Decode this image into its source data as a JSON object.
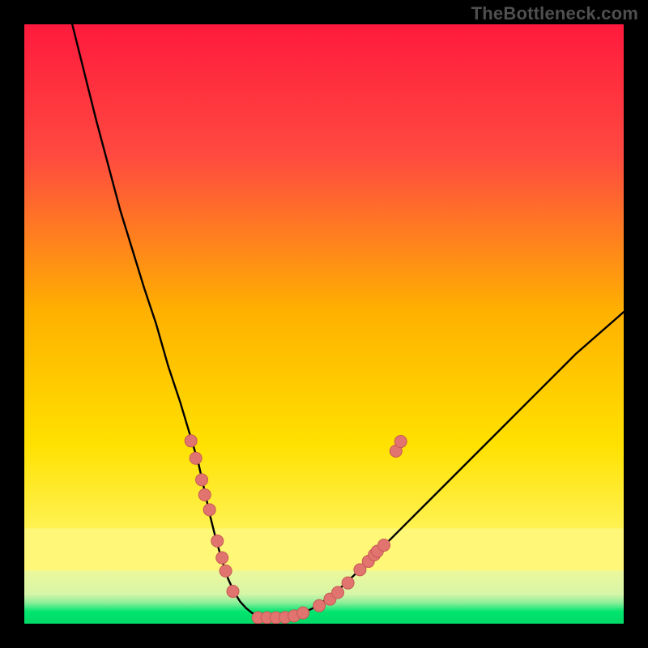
{
  "watermark": "TheBottleneck.com",
  "colors": {
    "frame": "#000000",
    "curve": "#000000",
    "dot_fill": "#e2746f",
    "dot_stroke": "#c65954",
    "grad_top": "#ff1a3d",
    "grad_upper": "#ff5040",
    "grad_mid": "#ffd300",
    "grad_band": "#fff777",
    "grad_lowband": "#ecf79b",
    "grad_green": "#00e56e"
  },
  "chart_data": {
    "type": "line",
    "title": "",
    "xlabel": "",
    "ylabel": "",
    "xlim": [
      0,
      100
    ],
    "ylim": [
      0,
      100
    ],
    "series": [
      {
        "name": "bottleneck-curve",
        "x": [
          8,
          12,
          16,
          20,
          22,
          24,
          26,
          27.5,
          29,
          30,
          31,
          32,
          33,
          34,
          35,
          36,
          37,
          38,
          39,
          40.5,
          42,
          44,
          46,
          48,
          50,
          53,
          56,
          60,
          64,
          68,
          73,
          78,
          85,
          92,
          100
        ],
        "y": [
          100,
          84,
          69,
          56,
          50,
          43,
          37,
          32,
          27,
          22.5,
          18,
          14,
          10.5,
          7.5,
          5.3,
          3.7,
          2.6,
          1.8,
          1.3,
          1.0,
          1.0,
          1.1,
          1.6,
          2.5,
          3.8,
          6.2,
          9,
          13,
          17,
          21,
          26,
          31,
          38,
          45,
          52
        ]
      }
    ],
    "dots_left": {
      "name": "left-cluster",
      "x": [
        27.8,
        28.6,
        29.6,
        30.1,
        30.9,
        32.2,
        33.0,
        33.6,
        34.8
      ],
      "y": [
        30.5,
        27.6,
        24.0,
        21.5,
        19.0,
        13.8,
        11.0,
        8.8,
        5.4
      ]
    },
    "dots_right": {
      "name": "right-cluster",
      "x": [
        49.2,
        51.0,
        52.3,
        54.0,
        56.0,
        57.4,
        58.4,
        58.9,
        60.0,
        62.0,
        62.8
      ],
      "y": [
        3.0,
        4.1,
        5.2,
        6.8,
        9.0,
        10.4,
        11.5,
        12.1,
        13.1,
        28.8,
        30.4
      ]
    },
    "dots_bottom": {
      "name": "bottom-cluster",
      "x": [
        39.0,
        40.5,
        42.0,
        43.5,
        45.0,
        46.5
      ],
      "y": [
        1.0,
        1.0,
        1.0,
        1.05,
        1.3,
        1.8
      ]
    }
  }
}
